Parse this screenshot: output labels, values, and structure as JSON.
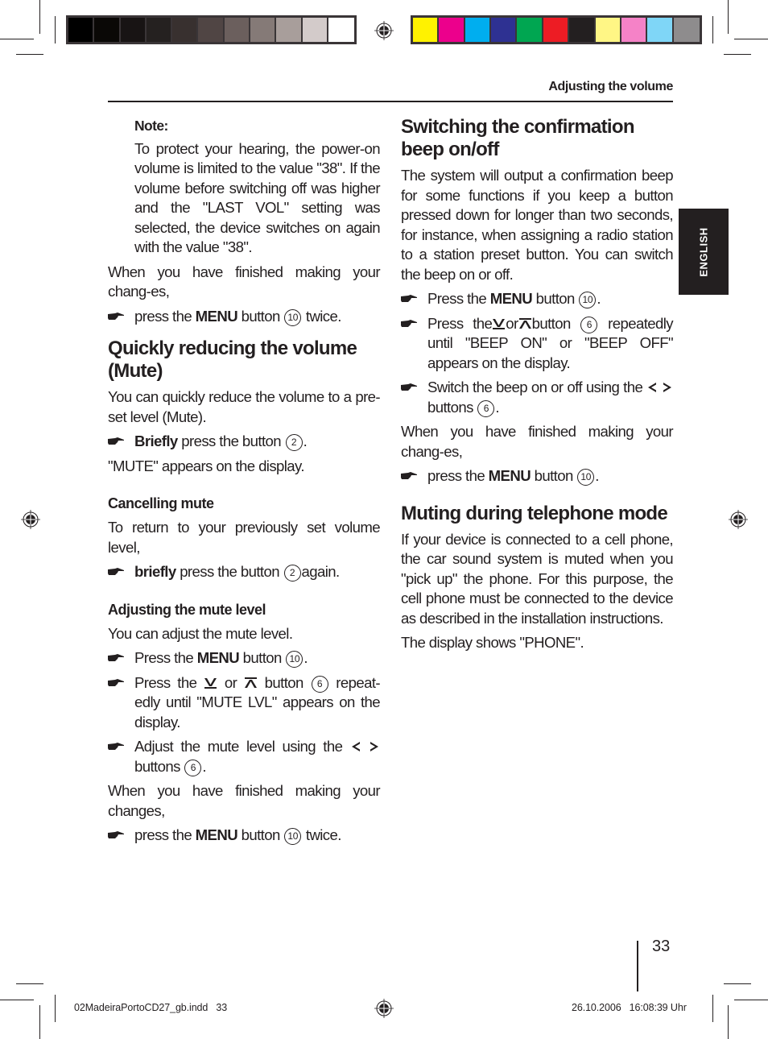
{
  "print_marks": {
    "gray_swatches": [
      "#000000",
      "#0a0806",
      "#181414",
      "#252120",
      "#38302f",
      "#504544",
      "#6b5f5d",
      "#857a77",
      "#a89e9b",
      "#d3cbca",
      "#ffffff"
    ],
    "color_swatches": [
      "#fff200",
      "#ec008c",
      "#00aeef",
      "#2e3192",
      "#00a651",
      "#ed1c24",
      "#231f20",
      "#fff685",
      "#f582c7",
      "#7fd6f7",
      "#8e8c8d"
    ],
    "slug_file": "02MadeiraPortoCD27_gb.indd   33",
    "slug_date": "26.10.2006   16:08:39 Uhr"
  },
  "header": {
    "running_head": "Adjusting the volume",
    "language_tab": "ENGLISH"
  },
  "left": {
    "note_label": "Note:",
    "note_body": "To protect your hearing, the power-on volume is limited to the value \"38\". If the volume before switching off was higher and the \"LAST VOL\" setting was selected, the device switches on again with the value \"38\".",
    "finish_text": "When you have finished making your chang-es,",
    "step_menu_twice": {
      "pre": "press the",
      "bold": "MENU",
      "mid": "button",
      "num": "10",
      "post": "twice."
    },
    "mute_heading": "Quickly reducing the volume (Mute)",
    "mute_intro": "You can quickly reduce the volume to a pre-set level (Mute).",
    "step_briefly": {
      "bold": "Briefly",
      "mid": "press the button",
      "num": "2",
      "post": "."
    },
    "mute_display": "\"MUTE\" appears on the display.",
    "cancel_heading": "Cancelling mute",
    "cancel_text": "To return to your previously set volume level,",
    "step_briefly_again": {
      "bold": "briefly",
      "mid": "press the button",
      "num": "2",
      "post": "again."
    },
    "adjust_heading": "Adjusting the mute level",
    "adjust_intro": "You can adjust the mute level.",
    "step_press_menu": {
      "pre": "Press the",
      "bold": "MENU",
      "mid": "button",
      "num": "10",
      "post": "."
    },
    "step_updown": {
      "pre": "Press the",
      "or": "or",
      "mid": "button",
      "num": "6",
      "post": "repeat-edly until \"MUTE LVL\" appears on the display."
    },
    "step_adjust": {
      "pre": "Adjust the mute level using the",
      "mid": "buttons",
      "num": "6",
      "post": "."
    },
    "finish_text_2": "When you have finished making your changes,",
    "step_menu_twice_2": {
      "pre": "press the",
      "bold": "MENU",
      "mid": "button",
      "num": "10",
      "post": "twice."
    }
  },
  "right": {
    "beep_heading": "Switching the confirmation beep on/off",
    "beep_intro": "The system will output a confirmation beep for some functions if you keep a button pressed down for longer than two seconds, for instance, when assigning a radio station to a station preset button. You can switch the beep on or off.",
    "step_press_menu": {
      "pre": "Press the",
      "bold": "MENU",
      "mid": "button",
      "num": "10",
      "post": "."
    },
    "step_updown": {
      "pre": "Press the",
      "or": "or",
      "mid": "button",
      "num": "6",
      "post": "repeatedly until \"BEEP ON\" or \"BEEP OFF\" appears on the display."
    },
    "step_switch": {
      "pre": "Switch the beep on or off using the",
      "mid": "buttons",
      "num": "6",
      "post": "."
    },
    "finish_text": "When you have finished making your chang-es,",
    "step_menu": {
      "pre": "press the",
      "bold": "MENU",
      "mid": "button",
      "num": "10",
      "post": "."
    },
    "phone_heading": "Muting during telephone mode",
    "phone_body": "If your device is connected to a cell phone, the car sound system is muted when you \"pick up\" the phone. For this purpose, the cell phone must be connected to the device as described in the installation instructions.",
    "phone_display": "The display shows \"PHONE\"."
  },
  "footer": {
    "page_number": "33"
  }
}
